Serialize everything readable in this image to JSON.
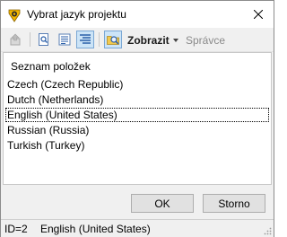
{
  "window": {
    "title": "Vybrat jazyk projektu"
  },
  "toolbar": {
    "view_label": "Zobrazit",
    "manager_label": "Správce"
  },
  "list": {
    "header": "Seznam položek",
    "items": [
      {
        "label": "Czech (Czech Republic)"
      },
      {
        "label": "Dutch (Netherlands)"
      },
      {
        "label": "English (United States)"
      },
      {
        "label": "Russian (Russia)"
      },
      {
        "label": "Turkish (Turkey)"
      }
    ],
    "focused_index": 2
  },
  "buttons": {
    "ok": "OK",
    "cancel": "Storno"
  },
  "status": {
    "id": "ID=2",
    "language": "English (United States)"
  },
  "colors": {
    "pressed": "#cce4f7",
    "window_bg": "#f0f0f0",
    "accent": "#f0b400"
  }
}
